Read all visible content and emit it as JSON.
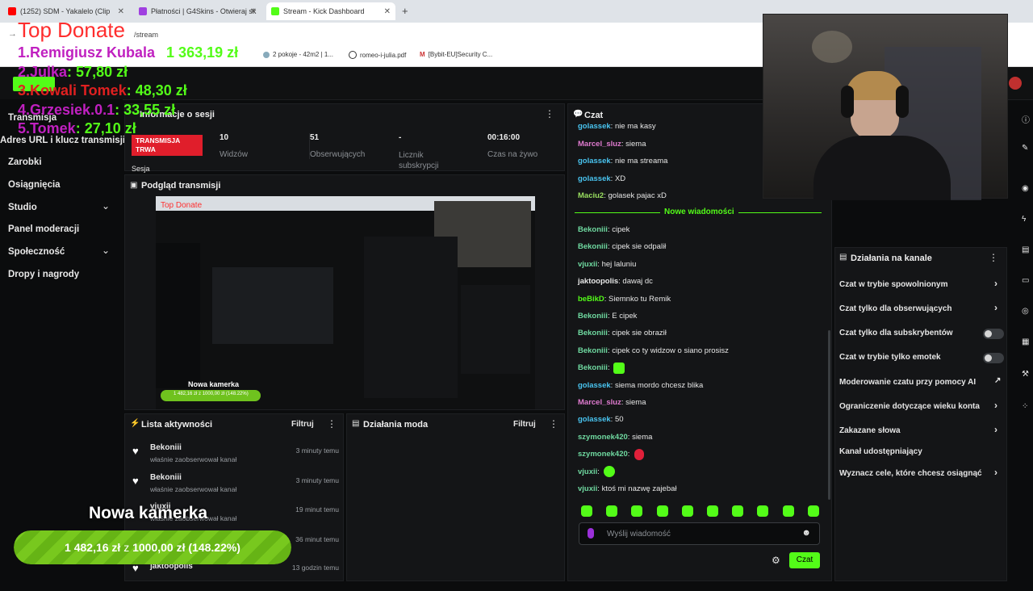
{
  "browser": {
    "tabs": [
      {
        "label": "(1252) SDM - Yakalelo (Clip",
        "icon_color": "#ff0000"
      },
      {
        "label": "Płatności | G4Skins - Otwieraj sk",
        "icon_color": "#a040e0"
      },
      {
        "label": "Stream - Kick Dashboard",
        "icon_color": "#53fc18"
      }
    ],
    "new_tab": "+",
    "url": "/stream",
    "bookmarks": [
      "2 pokoje - 42m2 | 1...",
      "romeo-i-julia.pdf",
      "[Bybit-EU]Security C..."
    ]
  },
  "overlay": {
    "title": "Top Donate",
    "donors": [
      {
        "rank": "1.",
        "name": "Remigiusz Kubala",
        "amount": "1 363,19 zł",
        "color": "#c020c0"
      },
      {
        "rank": "2.",
        "name": "Julka",
        "amount": ": 57,80 zł",
        "color": "#c020c0"
      },
      {
        "rank": "3.",
        "name": "Kowali Tomek",
        "amount": ": 48,30 zł",
        "color": "#e02020"
      },
      {
        "rank": "4.",
        "name": "Grzesiek.0.1",
        "amount": ": 33,55 zł",
        "color": "#c020c0"
      },
      {
        "rank": "5.",
        "name": "Tomek",
        "amount": ": 27,10 zł",
        "color": "#c020c0"
      }
    ],
    "goal_title": "Nowa kamerka",
    "goal_text_amount": "1 482,16 zł",
    "goal_text_of": "z",
    "goal_text_target": "1000,00 zł",
    "goal_text_percent": "(148.22%)",
    "goal_fraction": 1.0
  },
  "sidebar": {
    "items": [
      {
        "label": "Transmisja"
      },
      {
        "label": "Adres URL i klucz transmisji"
      },
      {
        "label": "Zarobki"
      },
      {
        "label": "Osiągnięcia"
      },
      {
        "label": "Studio",
        "chevron": true
      },
      {
        "label": "Panel moderacji"
      },
      {
        "label": "Społeczność",
        "chevron": true
      },
      {
        "label": "Dropy i nagrody"
      }
    ]
  },
  "session": {
    "title": "Informacje o sesji",
    "status_badge": "TRANSMISJA TRWA",
    "session_label": "Sesja",
    "stats": [
      {
        "value": "10",
        "label": "Widzów"
      },
      {
        "value": "51",
        "label": "Obserwujących"
      },
      {
        "value": "-",
        "label": "Licznik subskrypcji"
      },
      {
        "value": "00:16:00",
        "label": "Czas na żywo"
      }
    ]
  },
  "preview": {
    "title": "Podgląd transmisji",
    "mini_title": "Top Donate",
    "mini_goal": "Nowa kamerka",
    "mini_goal_text": "1 482,16 zł z 1000,00 zł (148.22%)"
  },
  "activity": {
    "title": "Lista aktywności",
    "filter": "Filtruj",
    "rows": [
      {
        "name": "Bekoniii",
        "desc": "właśnie zaobserwował kanał",
        "time": "3 minuty temu"
      },
      {
        "name": "Bekoniii",
        "desc": "właśnie zaobserwował kanał",
        "time": "3 minuty temu"
      },
      {
        "name": "vjuxii",
        "desc": "właśnie zaobserwował kanał",
        "time": "19 minut temu"
      },
      {
        "name": "",
        "desc": "",
        "time": "36 minut temu"
      },
      {
        "name": "jaktoopolis",
        "desc": "",
        "time": "13 godzin temu"
      }
    ]
  },
  "mod": {
    "title": "Działania moda",
    "filter": "Filtruj"
  },
  "chat": {
    "title": "Czat",
    "new_messages": "Nowe wiadomości",
    "messages_before": [
      {
        "user": "golassek",
        "color": "#49c4f0",
        "text": ": nie ma kasy"
      },
      {
        "user": "Marcel_sluz",
        "color": "#e07bd0",
        "text": ": siema"
      },
      {
        "user": "golassek",
        "color": "#49c4f0",
        "text": ": nie ma streama"
      },
      {
        "user": "golassek",
        "color": "#49c4f0",
        "text": ": XD"
      },
      {
        "user": "Maciu2",
        "color": "#9be060",
        "text": ": golasek pajac xD"
      }
    ],
    "messages_after": [
      {
        "user": "Bekoniii",
        "color": "#6fd9a0",
        "text": ": cipek"
      },
      {
        "user": "Bekoniii",
        "color": "#6fd9a0",
        "text": ": cipek sie odpalił"
      },
      {
        "user": "vjuxii",
        "color": "#6fd9a0",
        "text": ": hej laluniu"
      },
      {
        "user": "jaktoopolis",
        "color": "#e8e8e8",
        "text": ": dawaj dc"
      },
      {
        "user": "beBikD",
        "color": "#53fc18",
        "text": ": Siemnko tu Remik"
      },
      {
        "user": "Bekoniii",
        "color": "#6fd9a0",
        "text": ": E cipek"
      },
      {
        "user": "Bekoniii",
        "color": "#6fd9a0",
        "text": ": cipek sie obraził"
      },
      {
        "user": "Bekoniii",
        "color": "#6fd9a0",
        "text": ": cipek co ty widzow o siano prosisz"
      },
      {
        "user": "Bekoniii",
        "color": "#6fd9a0",
        "text": ":"
      },
      {
        "user": "golassek",
        "color": "#49c4f0",
        "text": ": siema mordo chcesz blika"
      },
      {
        "user": "Marcel_sluz",
        "color": "#e07bd0",
        "text": ": siema"
      },
      {
        "user": "golassek",
        "color": "#49c4f0",
        "text": ": 50"
      },
      {
        "user": "szymonek420",
        "color": "#6fd9a0",
        "text": ": siema"
      },
      {
        "user": "szymonek420",
        "color": "#6fd9a0",
        "text": ":"
      },
      {
        "user": "vjuxii",
        "color": "#6fd9a0",
        "text": ":"
      },
      {
        "user": "vjuxii",
        "color": "#6fd9a0",
        "text": ": ktoś mi nazwę zajebał"
      }
    ],
    "input_placeholder": "Wyślij wiadomość",
    "send_button": "Czat"
  },
  "channel_actions": {
    "title": "Działania na kanale",
    "options": [
      {
        "label": "Czat w trybie spowolnionym",
        "kind": "chevron"
      },
      {
        "label": "Czat tylko dla obserwujących",
        "kind": "chevron"
      },
      {
        "label": "Czat tylko dla subskrybentów",
        "kind": "toggle"
      },
      {
        "label": "Czat w trybie tylko emotek",
        "kind": "toggle"
      },
      {
        "label": "Moderowanie czatu przy pomocy AI",
        "kind": "external"
      },
      {
        "label": "Ograniczenie dotyczące wieku konta",
        "kind": "chevron"
      },
      {
        "label": "Zakazane słowa",
        "kind": "chevron"
      },
      {
        "label": "Kanał udostępniający",
        "kind": "none"
      },
      {
        "label": "Wyznacz cele, które chcesz osiągnąć",
        "kind": "chevron"
      }
    ]
  },
  "colors": {
    "kick_green": "#53fc18",
    "live_red": "#e01e2b",
    "bg": "#0b0c0d",
    "panel": "#141517"
  }
}
